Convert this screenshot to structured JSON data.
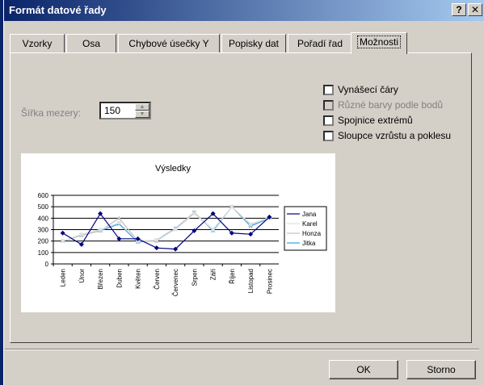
{
  "window": {
    "title": "Formát datové řady",
    "help_button": "?",
    "close_button": "✕"
  },
  "tabs": [
    {
      "label": "Vzorky"
    },
    {
      "label": "Osa"
    },
    {
      "label": "Chybové úsečky Y"
    },
    {
      "label": "Popisky dat"
    },
    {
      "label": "Pořadí řad"
    },
    {
      "label": "Možnosti"
    }
  ],
  "active_tab": "Možnosti",
  "options": {
    "gap_width_label": "Šířka mezery:",
    "gap_width_value": "150",
    "checkboxes": [
      {
        "label": "Vynášecí čáry",
        "checked": false,
        "enabled": true
      },
      {
        "label": "Různé barvy podle bodů",
        "checked": false,
        "enabled": false
      },
      {
        "label": "Spojnice extrémů",
        "checked": false,
        "enabled": true
      },
      {
        "label": "Sloupce vzrůstu a poklesu",
        "checked": false,
        "enabled": true
      }
    ]
  },
  "chart_data": {
    "type": "line",
    "title": "Výsledky",
    "categories": [
      "Leden",
      "Únor",
      "Březen",
      "Duben",
      "Květen",
      "Červen",
      "Červenec",
      "Srpen",
      "Září",
      "Říjen",
      "Listopad",
      "Prosinec"
    ],
    "yticks": [
      "0",
      "100",
      "200",
      "300",
      "400",
      "500",
      "600"
    ],
    "ylim": [
      0,
      600
    ],
    "grid": true,
    "legend_position": "right",
    "series": [
      {
        "name": "Jana",
        "color": "#000080",
        "values": [
          270,
          170,
          440,
          220,
          220,
          140,
          130,
          290,
          440,
          270,
          260,
          410
        ]
      },
      {
        "name": "Karel",
        "color": "#e0e0e0",
        "values": [
          200,
          260,
          300,
          360,
          200,
          210,
          300,
          440,
          300,
          500,
          350,
          400
        ]
      },
      {
        "name": "Honza",
        "color": "#c0c0c0",
        "values": [
          200,
          250,
          290,
          400,
          200,
          200,
          310,
          450,
          300,
          500,
          340,
          410
        ]
      },
      {
        "name": "Jitka",
        "color": "#2fa4e7",
        "values": [
          200,
          250,
          290,
          350,
          190,
          210,
          310,
          450,
          290,
          500,
          330,
          400
        ]
      }
    ]
  },
  "buttons": {
    "ok": "OK",
    "cancel": "Storno"
  }
}
